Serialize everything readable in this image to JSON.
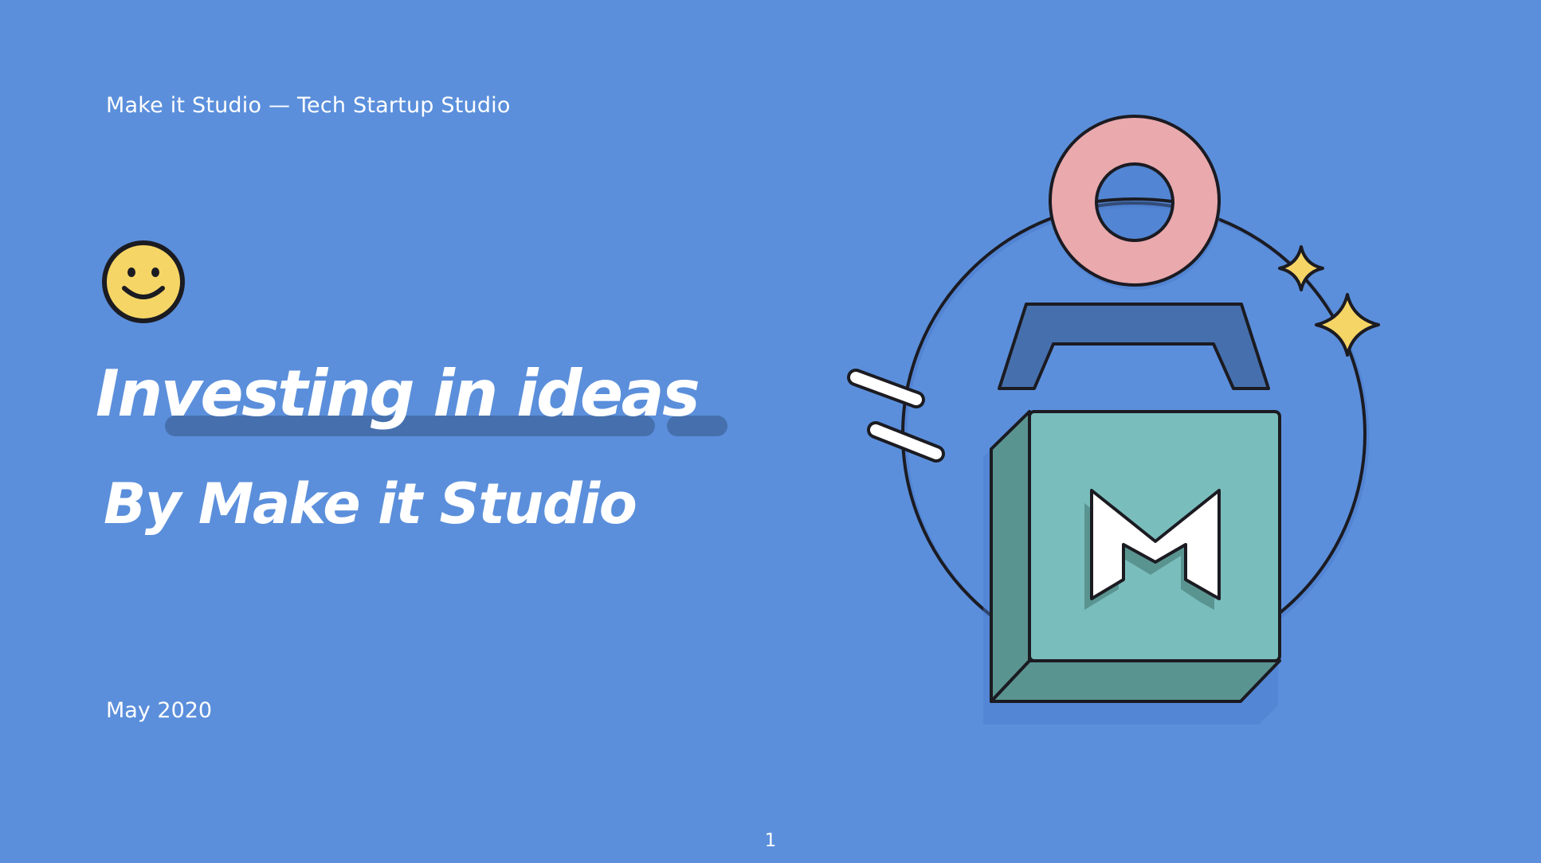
{
  "slide": {
    "organization_line": "Make it Studio — Tech Startup Studio",
    "title": "Investing in ideas",
    "subtitle": "By Make it Studio",
    "date": "May 2020",
    "page_number": "1"
  },
  "icons": {
    "emoji": "smiley-face-icon",
    "logo": "make-it-studio-m-logo",
    "decor": [
      "pink-ring",
      "blue-handle",
      "yellow-sparkle-small",
      "yellow-sparkle-large",
      "white-dash-lines",
      "orbit-circle"
    ]
  },
  "colors": {
    "background": "#5b8fdb",
    "text": "#ffffff",
    "underline": "#4670ad",
    "smiley": "#f5d565",
    "ring": "#e9a9ad",
    "handle": "#4670ad",
    "box_front": "#7abdbd",
    "box_side": "#5a9490",
    "sparkle": "#f5d565",
    "outline": "#1b1b22"
  }
}
